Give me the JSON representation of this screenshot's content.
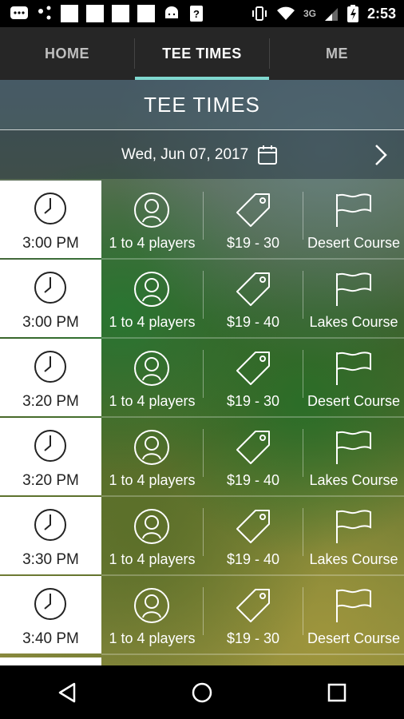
{
  "status_bar": {
    "time": "2:53",
    "network": "3G"
  },
  "tabs": [
    {
      "label": "HOME",
      "active": false
    },
    {
      "label": "TEE TIMES",
      "active": true
    },
    {
      "label": "ME",
      "active": false
    }
  ],
  "page_title": "TEE TIMES",
  "date": {
    "label": "Wed, Jun 07, 2017"
  },
  "accent_color": "#7fd8cf",
  "tee_times": [
    {
      "time": "3:00 PM",
      "players": "1 to 4 players",
      "price": "$19 - 30",
      "course": "Desert Course"
    },
    {
      "time": "3:00 PM",
      "players": "1 to 4 players",
      "price": "$19 - 40",
      "course": "Lakes Course"
    },
    {
      "time": "3:20 PM",
      "players": "1 to 4 players",
      "price": "$19 - 30",
      "course": "Desert Course"
    },
    {
      "time": "3:20 PM",
      "players": "1 to 4 players",
      "price": "$19 - 40",
      "course": "Lakes Course"
    },
    {
      "time": "3:30 PM",
      "players": "1 to 4 players",
      "price": "$19 - 40",
      "course": "Lakes Course"
    },
    {
      "time": "3:40 PM",
      "players": "1 to 4 players",
      "price": "$19 - 30",
      "course": "Desert Course"
    }
  ],
  "icons": {
    "time": "clock-icon",
    "players": "user-icon",
    "price": "price-tag-icon",
    "course": "flag-icon",
    "calendar": "calendar-icon",
    "next": "chevron-right-icon"
  }
}
